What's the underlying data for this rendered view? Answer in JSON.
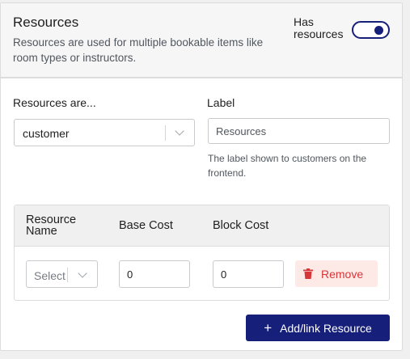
{
  "header": {
    "title": "Resources",
    "description": "Resources are used for multiple bookable items like room types or instructors.",
    "toggle_label": "Has resources",
    "toggle_on": true
  },
  "form": {
    "resources_are_label": "Resources are...",
    "resources_are_value": "customer",
    "label_label": "Label",
    "label_placeholder": "Resources",
    "label_value": "",
    "label_help": "The label shown to customers on the frontend."
  },
  "table": {
    "columns": [
      "Resource Name",
      "Base Cost",
      "Block Cost"
    ],
    "rows": [
      {
        "resource_select": "Select",
        "base_cost": "0",
        "block_cost": "0",
        "remove_label": "Remove"
      }
    ]
  },
  "actions": {
    "add_label": "Add/link Resource"
  },
  "icons": {
    "remove": "trash-icon",
    "add": "plus-icon",
    "select": "chevron-down-icon"
  },
  "colors": {
    "accent": "#16207a",
    "danger": "#d63638",
    "danger_bg": "#fde9e6"
  }
}
